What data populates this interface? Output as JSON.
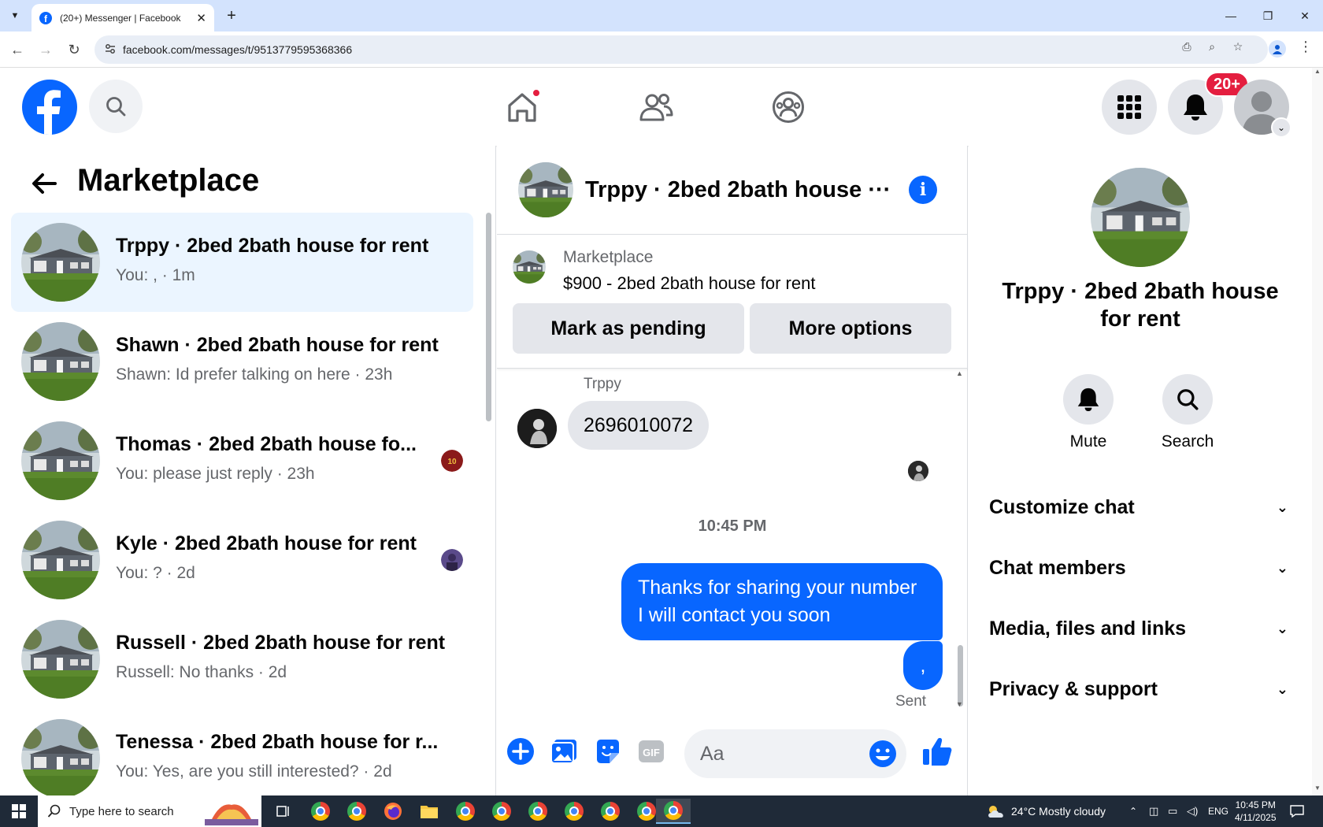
{
  "browser": {
    "tab_title": "(20+) Messenger | Facebook",
    "url": "facebook.com/messages/t/9513779595368366"
  },
  "header": {
    "notifications_badge": "20+"
  },
  "left": {
    "title": "Marketplace",
    "conversations": [
      {
        "name": "Trppy · 2bed 2bath house for rent",
        "preview": "You: , · 1m"
      },
      {
        "name": "Shawn · 2bed 2bath house for rent",
        "preview": "Shawn: Id prefer talking on here · 23h"
      },
      {
        "name": "Thomas · 2bed 2bath house fo...",
        "preview": "You: please just reply · 23h"
      },
      {
        "name": "Kyle · 2bed 2bath house for rent",
        "preview": "You: ? · 2d"
      },
      {
        "name": "Russell · 2bed 2bath house for rent",
        "preview": "Russell: No thanks · 2d"
      },
      {
        "name": "Tenessa · 2bed 2bath house for r...",
        "preview": "You: Yes, are you still interested? · 2d"
      }
    ]
  },
  "chat": {
    "title": "Trppy · 2bed 2bath house ···",
    "listing": {
      "label": "Marketplace",
      "price_title": "$900 - 2bed 2bath house for rent",
      "mark_pending": "Mark as pending",
      "more_options": "More options"
    },
    "sender_name": "Trppy",
    "incoming_message": "2696010072",
    "timestamp": "10:45 PM",
    "outgoing_message": "Thanks for sharing your number I will contact you soon",
    "outgoing_message_2": ",",
    "status": "Sent",
    "composer_placeholder": "Aa"
  },
  "details": {
    "name": "Trppy · 2bed 2bath house for rent",
    "mute_label": "Mute",
    "search_label": "Search",
    "sections": [
      "Customize chat",
      "Chat members",
      "Media, files and links",
      "Privacy & support"
    ]
  },
  "taskbar": {
    "search_placeholder": "Type here to search",
    "weather": "24°C  Mostly cloudy",
    "language": "ENG",
    "time": "10:45 PM",
    "date": "4/11/2025"
  },
  "colors": {
    "accent": "#0866ff",
    "badge": "#e41e3f",
    "active_row": "#ebf5ff"
  }
}
